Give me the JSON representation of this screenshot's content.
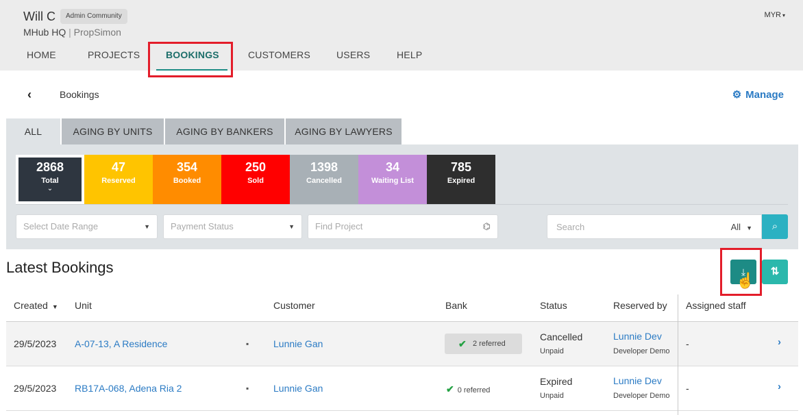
{
  "header": {
    "user_name": "Will C",
    "badge": "Admin Community",
    "org_primary": "MHub HQ",
    "org_separator": "|",
    "org_secondary": "PropSimon",
    "currency": "MYR",
    "currency_caret": "▾"
  },
  "nav": {
    "items": [
      {
        "label": "HOME"
      },
      {
        "label": "PROJECTS"
      },
      {
        "label": "BOOKINGS"
      },
      {
        "label": "CUSTOMERS"
      },
      {
        "label": "USERS"
      },
      {
        "label": "HELP"
      }
    ],
    "active": "BOOKINGS"
  },
  "breadcrumb": {
    "back_icon": "chevron-left-icon",
    "back_glyph": "‹",
    "current": "Bookings"
  },
  "manage": {
    "icon": "gear-icon",
    "icon_glyph": "⚙",
    "label": "Manage"
  },
  "tabs": [
    {
      "label": "ALL"
    },
    {
      "label": "AGING BY UNITS"
    },
    {
      "label": "AGING BY BANKERS"
    },
    {
      "label": "AGING BY LAWYERS"
    }
  ],
  "stats": [
    {
      "value": "2868",
      "label": "Total",
      "color": "#2e3640"
    },
    {
      "value": "47",
      "label": "Reserved",
      "color": "#ffc400"
    },
    {
      "value": "354",
      "label": "Booked",
      "color": "#ff8c00"
    },
    {
      "value": "250",
      "label": "Sold",
      "color": "#ff0000"
    },
    {
      "value": "1398",
      "label": "Cancelled",
      "color": "#a8b0b6"
    },
    {
      "value": "34",
      "label": "Waiting List",
      "color": "#c38fd9"
    },
    {
      "value": "785",
      "label": "Expired",
      "color": "#2e2e2e"
    }
  ],
  "stat_expand_glyph": "⌄",
  "filters": {
    "date_range_placeholder": "Select Date Range",
    "payment_status_placeholder": "Payment Status",
    "find_project_placeholder": "Find Project",
    "dropdown_glyph": "▼",
    "binoculars_glyph": "⌬",
    "search_placeholder": "Search",
    "search_scope": "All",
    "search_icon_glyph": "⌕"
  },
  "latest": {
    "title": "Latest Bookings",
    "download_glyph": "⤓",
    "sort_glyph": "⇅",
    "cursor_glyph": "☝"
  },
  "table": {
    "headers": {
      "created": "Created",
      "created_sort": "▼",
      "unit": "Unit",
      "customer": "Customer",
      "bank": "Bank",
      "status": "Status",
      "reserved_by": "Reserved by",
      "assigned_staff": "Assigned staff"
    },
    "note_glyph": "▪",
    "check_glyph": "✔",
    "row_chevron": "›",
    "rows": [
      {
        "created": "29/5/2023",
        "unit": "A-07-13, A Residence",
        "customer": "Lunnie Gan",
        "bank": "2 referred",
        "status": "Cancelled",
        "payment": "Unpaid",
        "reserved_by": "Lunnie Dev",
        "reserved_org": "Developer Demo",
        "assigned_staff": "-"
      },
      {
        "created": "29/5/2023",
        "unit": "RB17A-068, Adena Ria 2",
        "customer": "Lunnie Gan",
        "bank": "0 referred",
        "status": "Expired",
        "payment": "Unpaid",
        "reserved_by": "Lunnie Dev",
        "reserved_org": "Developer Demo",
        "assigned_staff": "-"
      }
    ]
  },
  "colors": {
    "accent": "#1c8c85",
    "link": "#2b7bc4",
    "highlight": "#e31d2a"
  }
}
